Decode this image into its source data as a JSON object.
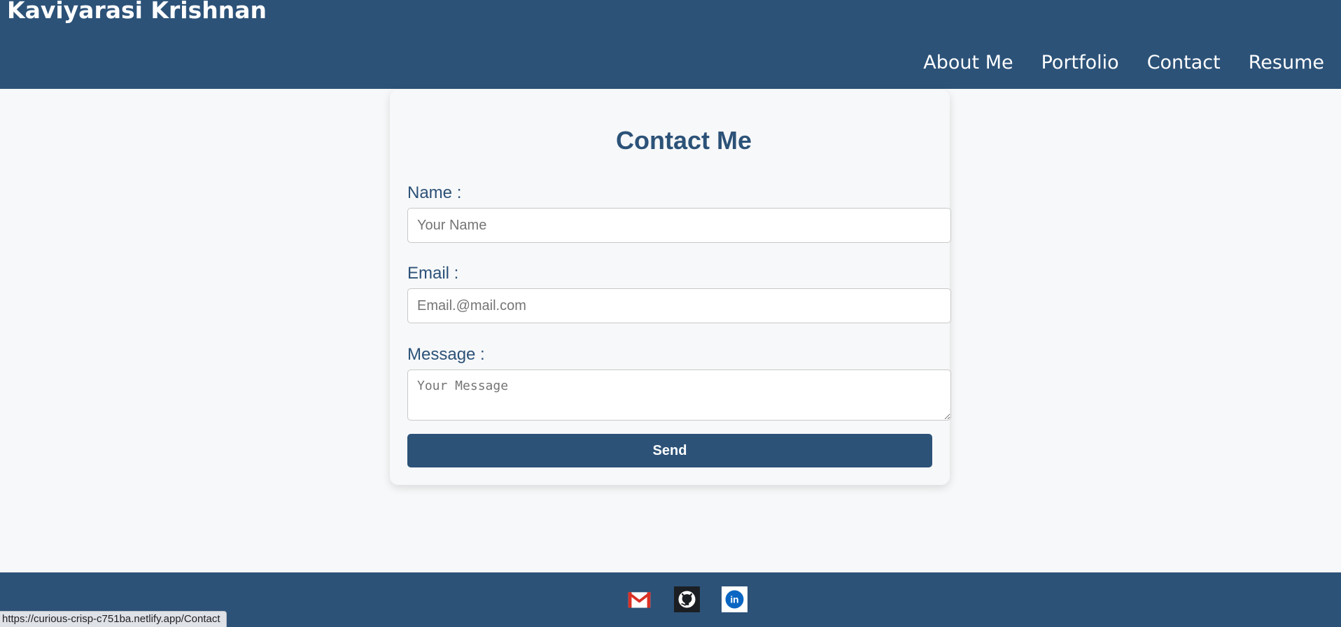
{
  "header": {
    "site_title": "Kaviyarasi Krishnan",
    "nav": [
      {
        "label": "About Me"
      },
      {
        "label": "Portfolio"
      },
      {
        "label": "Contact"
      },
      {
        "label": "Resume"
      }
    ]
  },
  "contact_form": {
    "title": "Contact Me",
    "name_label": "Name :",
    "name_placeholder": "Your Name",
    "email_label": "Email :",
    "email_placeholder": "Email.@mail.com",
    "message_label": "Message :",
    "message_placeholder": "Your Message",
    "send_label": "Send"
  },
  "footer": {
    "icons": [
      "gmail-icon",
      "github-icon",
      "linkedin-icon"
    ],
    "linkedin_text": "in"
  },
  "status_bar": {
    "url": "https://curious-crisp-c751ba.netlify.app/Contact"
  },
  "colors": {
    "primary": "#2c5278",
    "background": "#f7f8f9",
    "gmail_red": "#d93025",
    "linkedin_blue": "#0a66c2"
  }
}
